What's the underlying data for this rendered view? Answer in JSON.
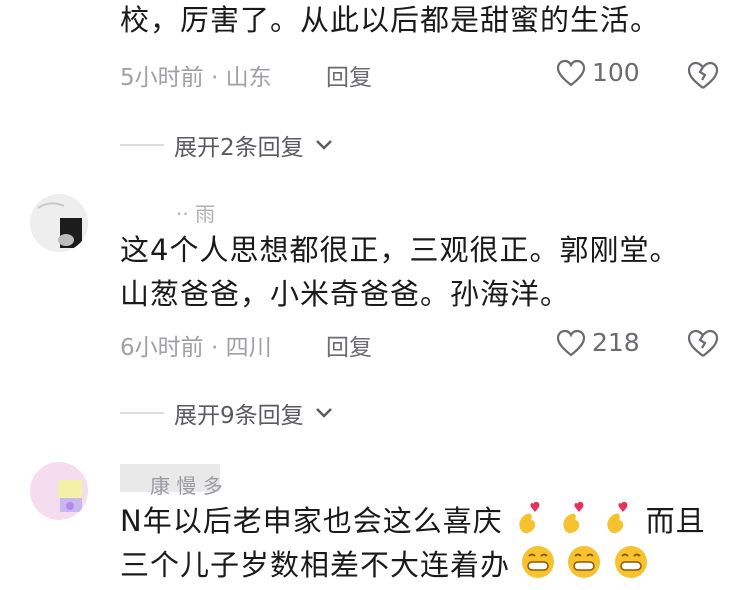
{
  "comments": [
    {
      "text_lines": [
        "校，厉害了。从此以后都是甜蜜的生活。"
      ],
      "meta": "5小时前 · 山东",
      "reply_label": "回复",
      "likes": "100",
      "expand_label": "展开2条回复"
    },
    {
      "name": "·· 雨",
      "text_lines": [
        "这4个人思想都很正，三观很正。郭刚堂。",
        "山葱爸爸，小米奇爸爸。孙海洋。"
      ],
      "meta": "6小时前 · 四川",
      "reply_label": "回复",
      "likes": "218",
      "expand_label": "展开9条回复"
    },
    {
      "name": "康 慢 多",
      "text_lines": [
        "N年以后老申家也会这么喜庆",
        "而且",
        "三个儿子岁数相差不大连着办"
      ]
    }
  ],
  "icons": {
    "like": "heart-outline-icon",
    "dislike": "broken-heart-icon",
    "expand": "chevron-down-icon",
    "emoji_heart_hands": "finger-heart-emoji",
    "emoji_grin": "grinning-face-emoji"
  },
  "colors": {
    "text": "#1a1a1a",
    "meta": "#a0a0a5",
    "emoji_yellow": "#f7c22f",
    "emoji_heart": "#e8315a"
  }
}
